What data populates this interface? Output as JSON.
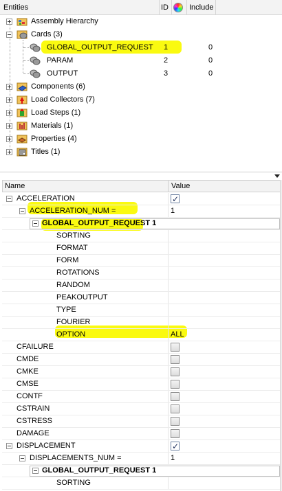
{
  "entities_panel": {
    "header": {
      "entities": "Entities",
      "id": "ID",
      "include": "Include"
    },
    "items": [
      {
        "label": "Assembly Hierarchy",
        "icon": "assembly-icon"
      },
      {
        "label": "Cards (3)",
        "icon": "cards-icon",
        "expanded": true,
        "children": [
          {
            "label": "GLOBAL_OUTPUT_REQUEST",
            "id": "1",
            "include": "0",
            "highlighted": true
          },
          {
            "label": "PARAM",
            "id": "2",
            "include": "0"
          },
          {
            "label": "OUTPUT",
            "id": "3",
            "include": "0"
          }
        ]
      },
      {
        "label": "Components (6)",
        "icon": "components-icon"
      },
      {
        "label": "Load Collectors (7)",
        "icon": "load-collectors-icon"
      },
      {
        "label": "Load Steps (1)",
        "icon": "load-steps-icon"
      },
      {
        "label": "Materials (1)",
        "icon": "materials-icon"
      },
      {
        "label": "Properties (4)",
        "icon": "properties-icon"
      },
      {
        "label": "Titles (1)",
        "icon": "titles-icon"
      }
    ]
  },
  "property_grid": {
    "header": {
      "name": "Name",
      "value": "Value"
    },
    "rows": [
      {
        "name": "ACCELERATION",
        "checked": true
      },
      {
        "name": "ACCELERATION_NUM =",
        "value": "1"
      },
      {
        "name": "GLOBAL_OUTPUT_REQUEST 1"
      },
      {
        "name": "SORTING"
      },
      {
        "name": "FORMAT"
      },
      {
        "name": "FORM"
      },
      {
        "name": "ROTATIONS"
      },
      {
        "name": "RANDOM"
      },
      {
        "name": "PEAKOUTPUT"
      },
      {
        "name": "TYPE"
      },
      {
        "name": "FOURIER"
      },
      {
        "name": "OPTION",
        "value": "ALL"
      },
      {
        "name": "CFAILURE",
        "checked": false
      },
      {
        "name": "CMDE",
        "checked": false
      },
      {
        "name": "CMKE",
        "checked": false
      },
      {
        "name": "CMSE",
        "checked": false
      },
      {
        "name": "CONTF",
        "checked": false
      },
      {
        "name": "CSTRAIN",
        "checked": false
      },
      {
        "name": "CSTRESS",
        "checked": false
      },
      {
        "name": "DAMAGE",
        "checked": false
      },
      {
        "name": "DISPLACEMENT",
        "checked": true
      },
      {
        "name": "DISPLACEMENTS_NUM =",
        "value": "1"
      },
      {
        "name": "GLOBAL_OUTPUT_REQUEST 1"
      },
      {
        "name": "SORTING"
      }
    ]
  },
  "colors": {
    "highlight": "#fafa10",
    "header_bg": "#f3f3f3"
  }
}
